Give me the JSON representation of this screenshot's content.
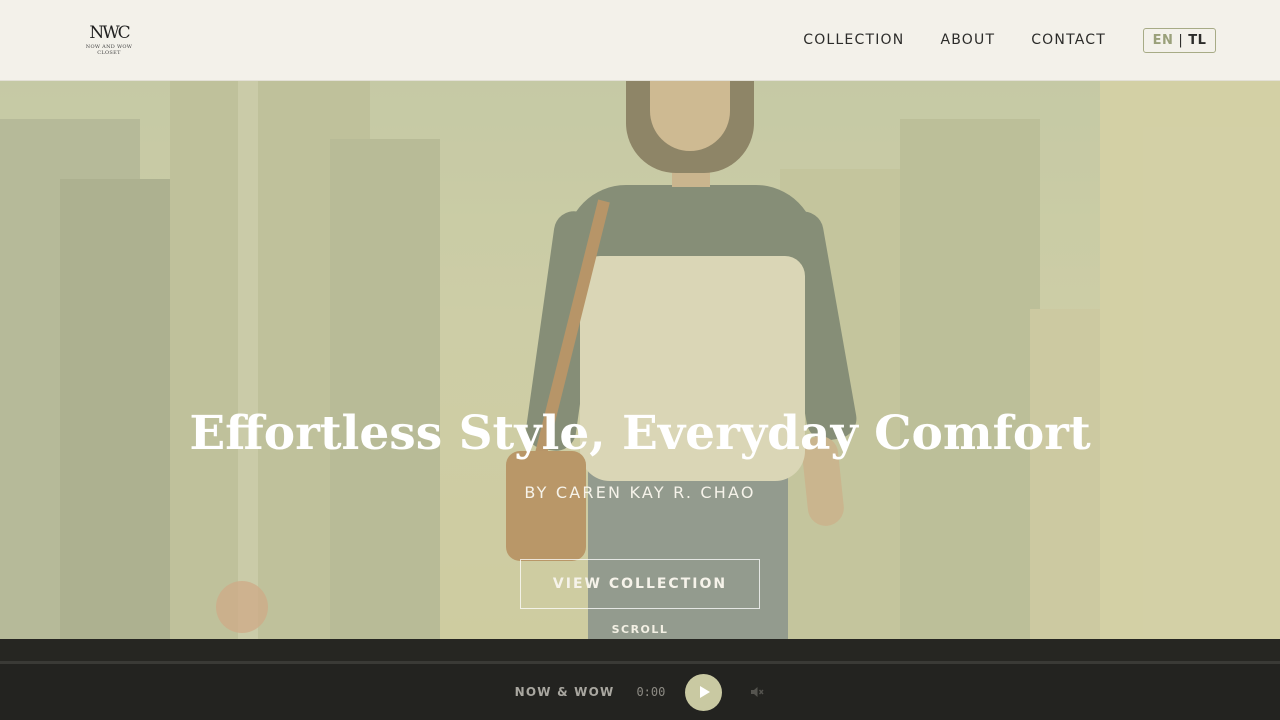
{
  "header": {
    "logo": {
      "mark": "NWC",
      "tagline_line1": "NOW AND WOW",
      "tagline_line2": "CLOSET"
    },
    "nav": [
      {
        "label": "COLLECTION"
      },
      {
        "label": "ABOUT"
      },
      {
        "label": "CONTACT"
      }
    ],
    "language": {
      "active": "EN",
      "separator": "|",
      "other": "TL"
    }
  },
  "hero": {
    "title": "Effortless Style, Everyday Comfort",
    "subtitle": "BY CAREN KAY R. CHAO",
    "cta_label": "VIEW COLLECTION",
    "scroll_label": "SCROLL"
  },
  "player": {
    "track_name": "NOW & WOW",
    "time": "0:00",
    "play_icon": "play-icon",
    "mute_icon": "muted-speaker-icon"
  },
  "colors": {
    "accent": "#c9c9a2",
    "lang_active": "#9aa07a",
    "header_bg": "#f3f1ea",
    "player_bg": "#232320"
  }
}
